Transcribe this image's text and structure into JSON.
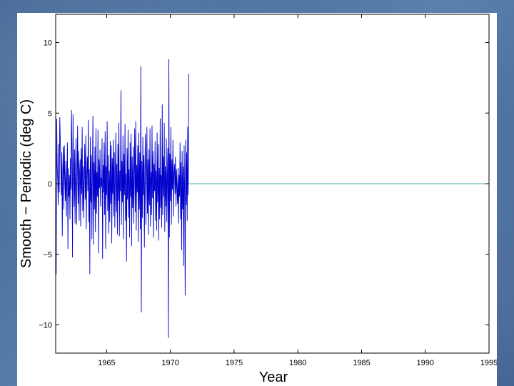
{
  "chart_data": {
    "type": "line",
    "xlabel": "Year",
    "ylabel": "Smooth − Periodic (deg C)",
    "xlim": [
      1961,
      1995
    ],
    "ylim": [
      -12,
      12
    ],
    "xticks": [
      1965,
      1970,
      1975,
      1980,
      1985,
      1990,
      1995
    ],
    "xtick_labels": [
      "1965",
      "1970",
      "1975",
      "1980",
      "1985",
      "1990",
      "1995"
    ],
    "yticks": [
      -10,
      -5,
      0,
      5,
      10
    ],
    "ytick_labels": [
      "−10",
      "−5",
      "0",
      "5",
      "10"
    ],
    "grid": false,
    "line_color": "#0000cc",
    "zero_line_color": "#4aa8a8",
    "series": [
      {
        "x_start": 1961,
        "x_step": 0.04,
        "values": [
          -2.0,
          -6.4,
          4.6,
          1.2,
          0.3,
          -1.5,
          2.8,
          -0.6,
          4.7,
          3.1,
          1.5,
          -0.8,
          2.2,
          -3.7,
          0.9,
          2.6,
          -1.8,
          2.7,
          0.4,
          -1.2,
          1.6,
          -2.3,
          0.7,
          2.9,
          -4.6,
          1.1,
          -0.9,
          0.6,
          -2.5,
          1.8,
          -0.4,
          5.2,
          2.1,
          -5.2,
          4.9,
          0.8,
          -1.6,
          2.4,
          -2.8,
          1.3,
          3.2,
          -2.9,
          0.5,
          4.1,
          -1.4,
          2.3,
          -2.6,
          0.9,
          1.7,
          -3.0,
          2.5,
          -0.7,
          4.0,
          -1.9,
          1.2,
          -2.4,
          0.3,
          2.8,
          -1.1,
          3.4,
          -3.2,
          0.6,
          1.9,
          -0.5,
          4.5,
          -2.7,
          1.0,
          -6.4,
          3.3,
          -1.3,
          2.0,
          -3.9,
          0.7,
          4.8,
          -4.3,
          1.5,
          -1.8,
          2.6,
          -3.4,
          3.9,
          -2.1,
          0.8,
          -0.9,
          3.8,
          -4.9,
          1.7,
          -0.3,
          2.4,
          -1.6,
          0.4,
          -0.2,
          3.2,
          -5.3,
          1.3,
          -0.6,
          2.9,
          -2.2,
          3.7,
          -4.6,
          1.2,
          -0.8,
          4.4,
          -1.9,
          2.0,
          -3.5,
          0.9,
          -2.7,
          3.0,
          -1.4,
          2.7,
          -4.2,
          1.8,
          -0.7,
          3.1,
          -2.3,
          2.2,
          -3.1,
          0.6,
          3.6,
          -2.0,
          1.4,
          -3.6,
          2.8,
          -1.2,
          4.3,
          -3.7,
          0.9,
          -0.5,
          6.6,
          -2.9,
          1.6,
          -1.3,
          3.4,
          -3.9,
          2.1,
          -0.8,
          4.2,
          -2.6,
          0.7,
          -5.5,
          2.5,
          -1.1,
          3.8,
          -2.4,
          1.0,
          -3.8,
          2.9,
          -0.9,
          3.5,
          -4.4,
          1.9,
          -1.7,
          2.6,
          -2.8,
          0.5,
          3.9,
          -2.0,
          4.4,
          -3.3,
          1.3,
          -0.6,
          2.7,
          -4.1,
          3.6,
          -1.8,
          2.2,
          -3.2,
          8.3,
          -9.1,
          1.6,
          -2.4,
          3.3,
          -0.8,
          2.0,
          -4.5,
          1.1,
          3.5,
          -2.9,
          0.4,
          4.0,
          -2.1,
          1.7,
          -3.6,
          2.4,
          -1.5,
          3.9,
          -3.0,
          0.8,
          -2.2,
          4.1,
          -1.0,
          2.3,
          -3.8,
          1.4,
          -0.5,
          3.0,
          -2.6,
          0.9,
          -3.3,
          3.6,
          -1.3,
          2.8,
          -4.0,
          1.1,
          -2.5,
          4.6,
          -1.7,
          0.6,
          -3.1,
          5.6,
          -2.2,
          1.9,
          -0.9,
          4.3,
          -3.4,
          1.2,
          -1.6,
          3.2,
          -2.7,
          0.5,
          2.5,
          -10.9,
          8.8,
          -3.8,
          2.1,
          -1.2,
          4.0,
          -2.9,
          1.7,
          -0.4,
          3.1,
          -2.3,
          0.8,
          1.4,
          -0.7,
          1.9,
          -1.6,
          1.0,
          -0.3,
          -1.4,
          1.1,
          -2.8,
          0.6,
          -0.9,
          2.9,
          -2.5,
          1.5,
          -4.7,
          2.3,
          -1.8,
          1.2,
          -5.8,
          2.7,
          -0.6,
          -7.9,
          3.1,
          -1.5,
          2.2,
          -2.6,
          4.0,
          -0.8,
          7.8
        ]
      }
    ]
  }
}
